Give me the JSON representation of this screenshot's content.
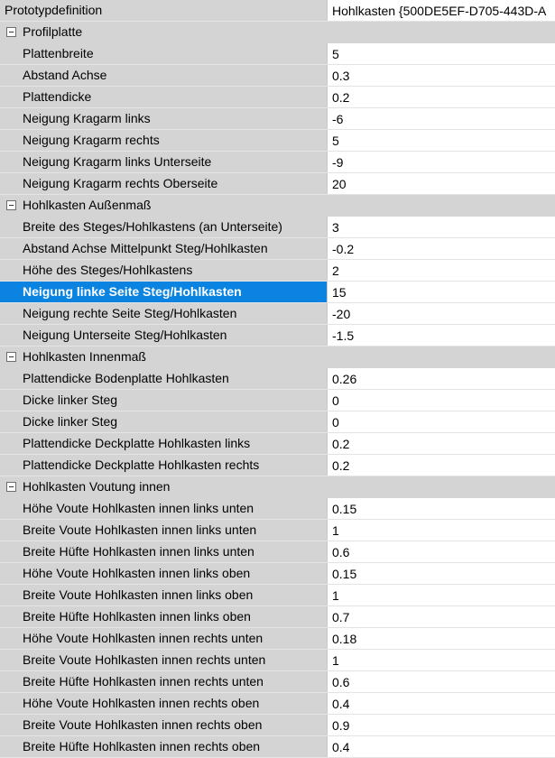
{
  "prototype": {
    "label": "Prototypdefinition",
    "value": "Hohlkasten {500DE5EF-D705-443D-A"
  },
  "categories": [
    {
      "title": "Profilplatte",
      "rows": [
        {
          "name": "Plattenbreite",
          "value": "5"
        },
        {
          "name": "Abstand Achse",
          "value": "0.3"
        },
        {
          "name": "Plattendicke",
          "value": "0.2"
        },
        {
          "name": "Neigung Kragarm links",
          "value": "-6"
        },
        {
          "name": "Neigung Kragarm rechts",
          "value": "5"
        },
        {
          "name": "Neigung Kragarm links Unterseite",
          "value": "-9"
        },
        {
          "name": "Neigung Kragarm rechts Oberseite",
          "value": "20"
        }
      ]
    },
    {
      "title": "Hohlkasten Außenmaß",
      "rows": [
        {
          "name": "Breite des Steges/Hohlkastens (an Unterseite)",
          "value": "3"
        },
        {
          "name": "Abstand Achse Mittelpunkt Steg/Hohlkasten",
          "value": "-0.2"
        },
        {
          "name": "Höhe des Steges/Hohlkastens",
          "value": "2"
        },
        {
          "name": "Neigung linke Seite Steg/Hohlkasten",
          "value": "15",
          "selected": true
        },
        {
          "name": "Neigung rechte Seite Steg/Hohlkasten",
          "value": "-20"
        },
        {
          "name": "Neigung Unterseite Steg/Hohlkasten",
          "value": "-1.5"
        }
      ]
    },
    {
      "title": "Hohlkasten Innenmaß",
      "rows": [
        {
          "name": "Plattendicke Bodenplatte Hohlkasten",
          "value": "0.26"
        },
        {
          "name": "Dicke linker Steg",
          "value": "0"
        },
        {
          "name": "Dicke linker Steg",
          "value": "0"
        },
        {
          "name": "Plattendicke Deckplatte Hohlkasten links",
          "value": "0.2"
        },
        {
          "name": "Plattendicke Deckplatte Hohlkasten rechts",
          "value": "0.2"
        }
      ]
    },
    {
      "title": "Hohlkasten Voutung innen",
      "rows": [
        {
          "name": "Höhe Voute Hohlkasten innen links unten",
          "value": "0.15"
        },
        {
          "name": "Breite Voute Hohlkasten innen links unten",
          "value": "1"
        },
        {
          "name": "Breite Hüfte Hohlkasten innen links unten",
          "value": "0.6"
        },
        {
          "name": "Höhe Voute Hohlkasten innen links oben",
          "value": "0.15"
        },
        {
          "name": "Breite Voute Hohlkasten innen links oben",
          "value": "1"
        },
        {
          "name": "Breite Hüfte Hohlkasten innen links oben",
          "value": "0.7"
        },
        {
          "name": "Höhe Voute Hohlkasten innen rechts unten",
          "value": "0.18"
        },
        {
          "name": "Breite Voute Hohlkasten innen rechts unten",
          "value": "1"
        },
        {
          "name": "Breite Hüfte Hohlkasten innen rechts unten",
          "value": "0.6"
        },
        {
          "name": "Höhe Voute Hohlkasten innen rechts oben",
          "value": "0.4"
        },
        {
          "name": "Breite Voute Hohlkasten innen rechts oben",
          "value": "0.9"
        },
        {
          "name": "Breite Hüfte Hohlkasten innen rechts oben",
          "value": "0.4"
        }
      ]
    }
  ],
  "colors": {
    "name_column_bg": "#d4d4d4",
    "value_column_bg": "#ffffff",
    "selection_bg": "#0a84e0",
    "selection_text": "#ffffff"
  },
  "icons": {
    "category_toggle": "collapse-minus-icon"
  }
}
